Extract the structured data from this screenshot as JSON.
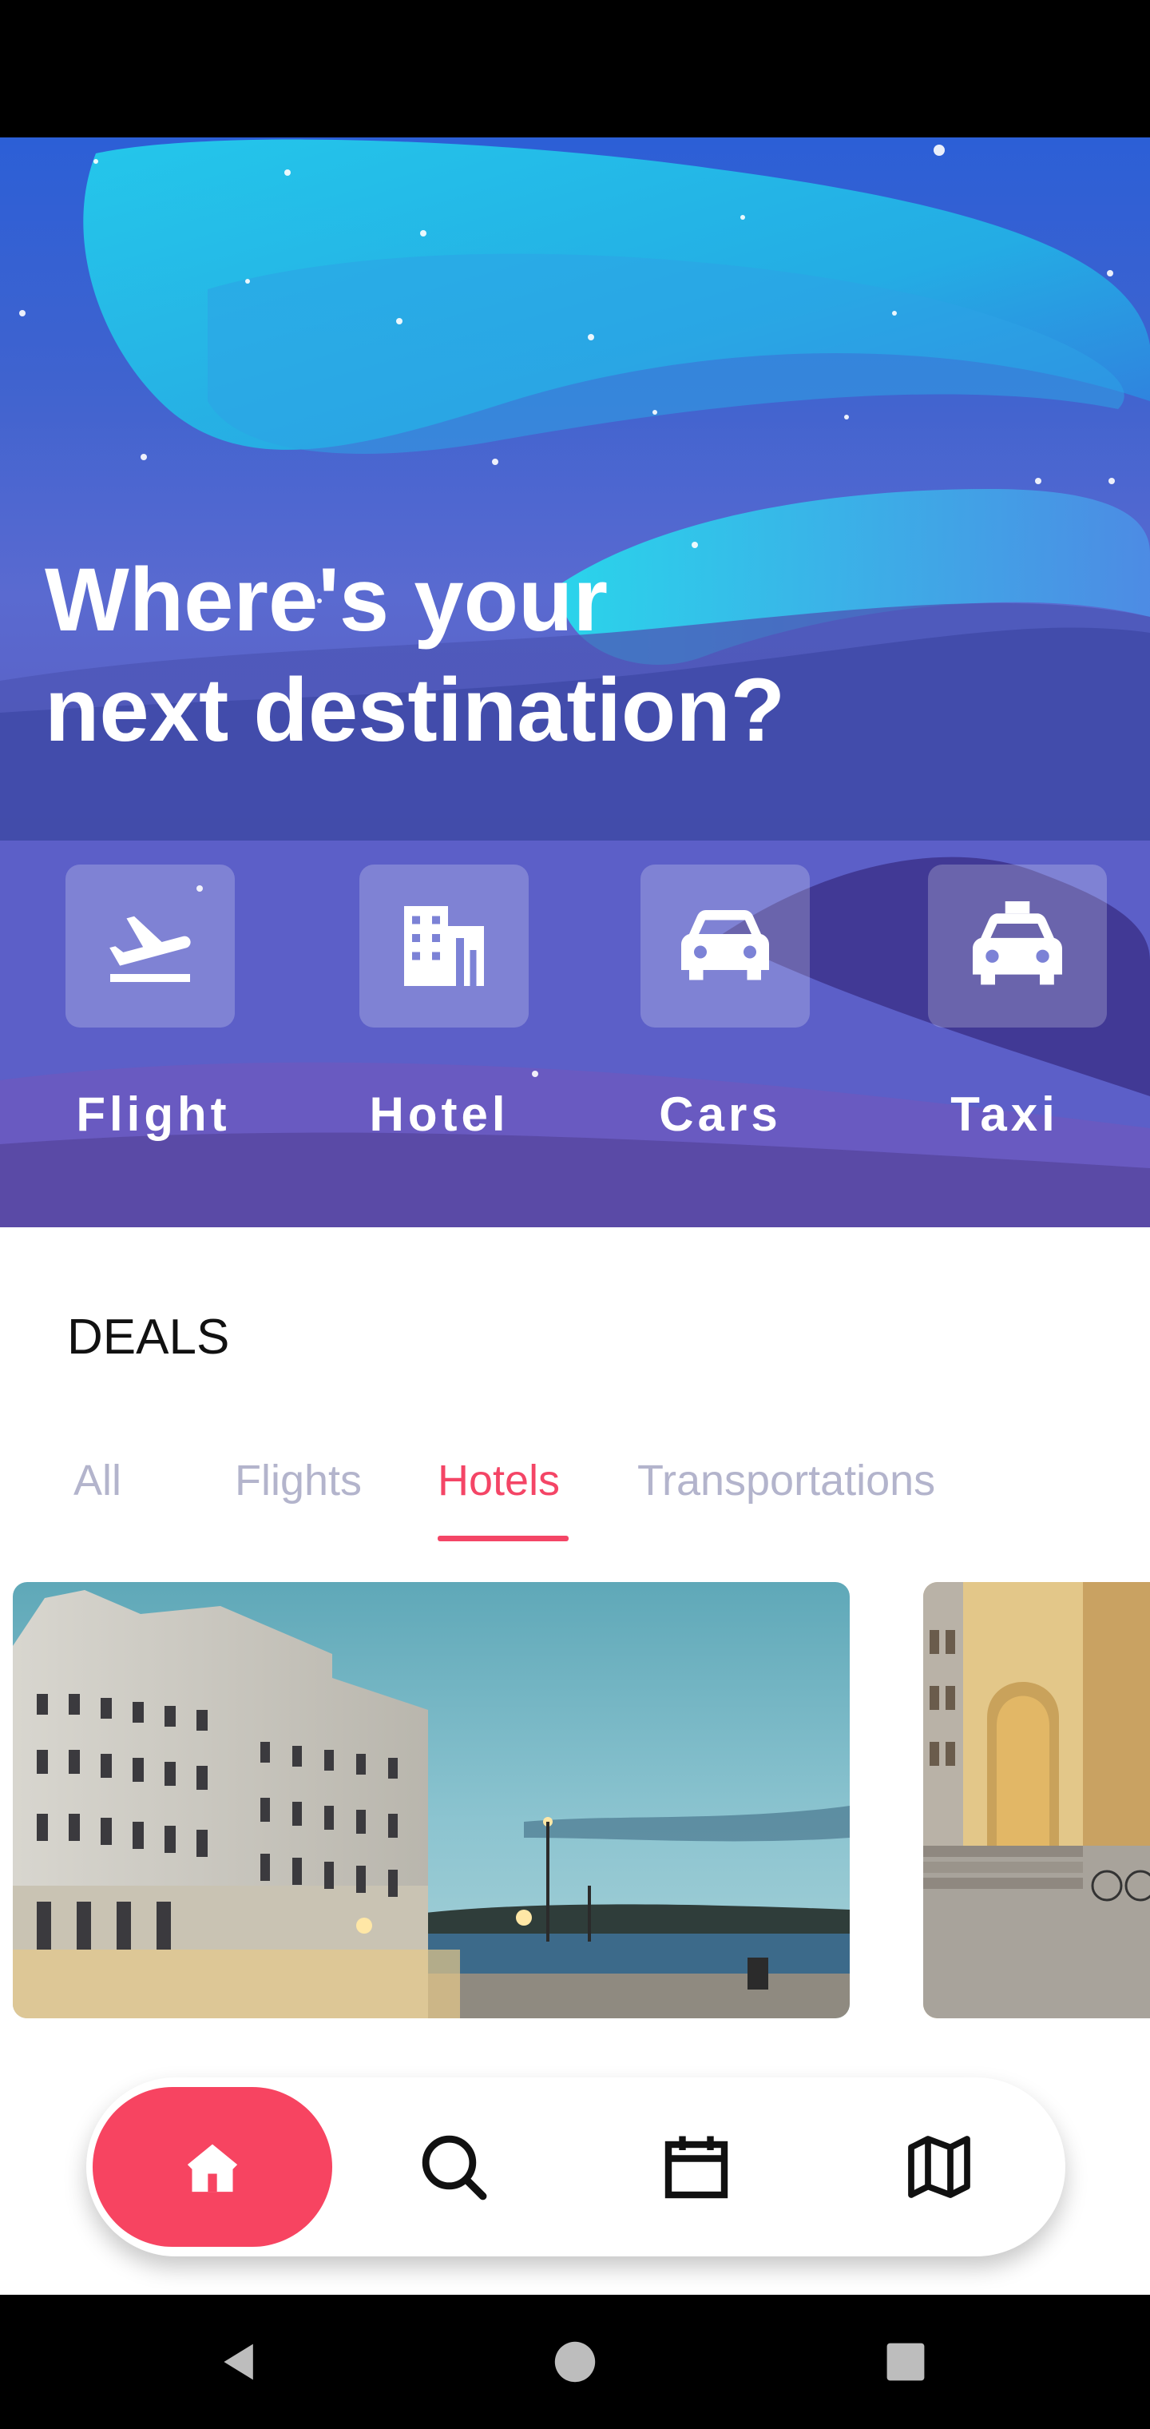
{
  "hero": {
    "title": "Where's your\nnext destination?",
    "categories": [
      {
        "label": "Flight",
        "icon": "flight-takeoff-icon"
      },
      {
        "label": "Hotel",
        "icon": "hotel-building-icon"
      },
      {
        "label": "Cars",
        "icon": "car-icon"
      },
      {
        "label": "Taxi",
        "icon": "taxi-icon"
      }
    ]
  },
  "deals": {
    "title": "DEALS",
    "tabs": [
      "All",
      "Flights",
      "Hotels",
      "Transportations"
    ],
    "selected_tab": "Hotels"
  },
  "bottom_nav": {
    "items": [
      "home-icon",
      "search-icon",
      "calendar-icon",
      "map-icon"
    ],
    "active": "home-icon"
  },
  "system_nav": [
    "back-icon",
    "home-circle-icon",
    "recents-icon"
  ],
  "colors": {
    "accent": "#f44566",
    "tab_inactive": "#b3b4cc",
    "hero_overlay": "#5b5fc4"
  }
}
